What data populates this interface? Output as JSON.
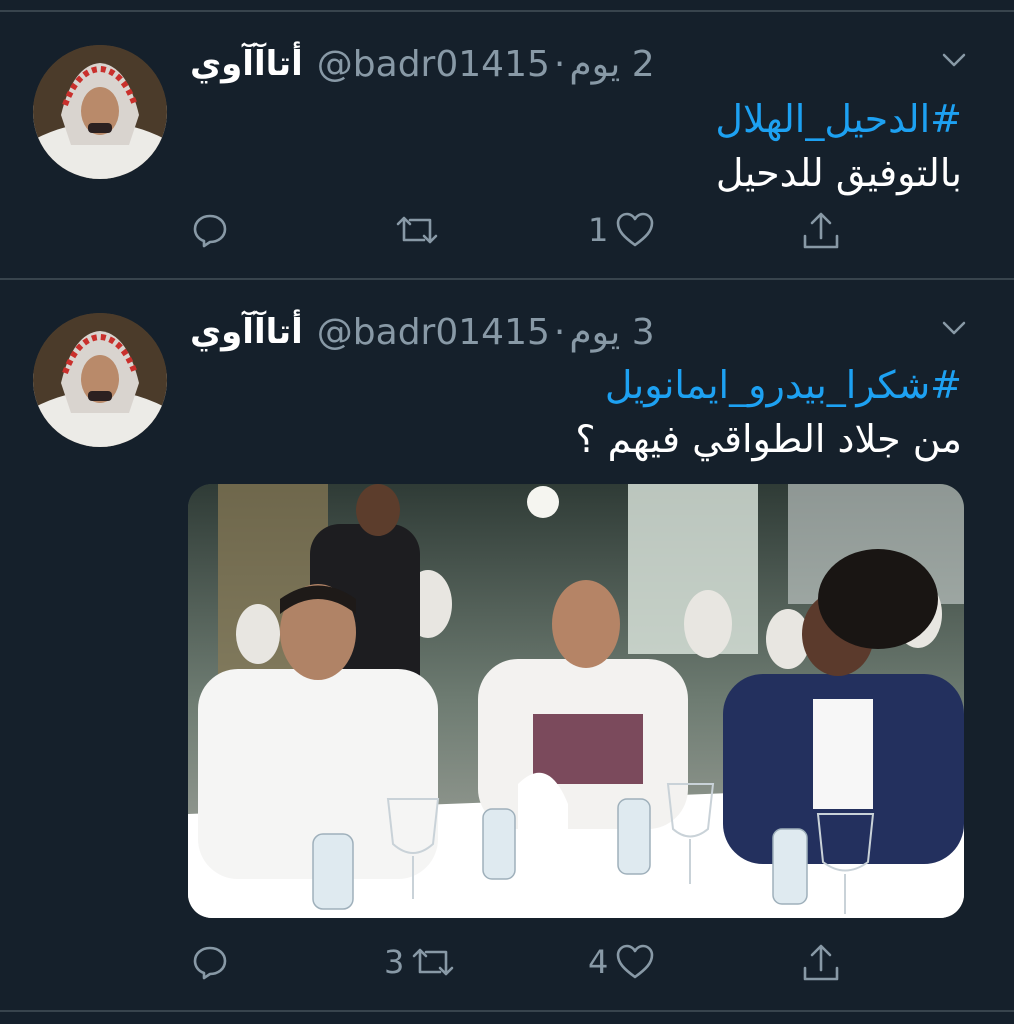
{
  "tweets": [
    {
      "name": "أتاآآوي",
      "handle": "@badr01415",
      "separator": "·",
      "time": "2 يوم",
      "hashtag": "#الدحيل_الهلال",
      "text": "بالتوفيق للدحيل",
      "actions": {
        "reply": "",
        "retweet": "",
        "like": "1",
        "share": ""
      }
    },
    {
      "name": "أتاآآوي",
      "handle": "@badr01415",
      "separator": "·",
      "time": "3 يوم",
      "hashtag": "#شكرا_بيدرو_ايمانويل",
      "text": "من جلاد الطواقي فيهم ؟",
      "actions": {
        "reply": "",
        "retweet": "3",
        "like": "4",
        "share": ""
      }
    }
  ],
  "icons": {
    "reply": "reply-icon",
    "retweet": "retweet-icon",
    "like": "heart-icon",
    "share": "share-icon",
    "more": "chevron-down-icon"
  },
  "colors": {
    "background": "#15202b",
    "divider": "#38444d",
    "secondary": "#8899a6",
    "link": "#1da1f2"
  }
}
